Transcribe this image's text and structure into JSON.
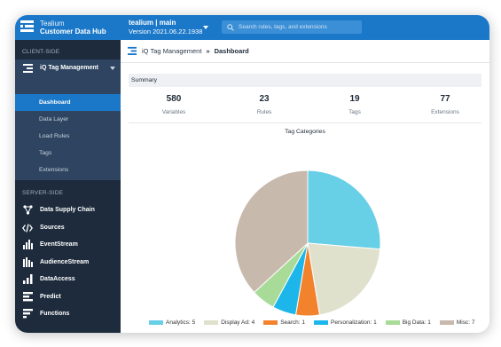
{
  "header": {
    "brand_line1": "Tealium",
    "brand_line2": "Customer Data Hub",
    "account_line": "tealium  |  main",
    "version_line": "Version 2021.06.22.1938",
    "search_placeholder": "Search rules, tags, and extensions"
  },
  "sidebar": {
    "client_title": "CLIENT-SIDE",
    "iq_label": "iQ Tag Management",
    "iq_items": [
      "Dashboard",
      "Data Layer",
      "Load Rules",
      "Tags",
      "Extensions"
    ],
    "server_title": "SERVER-SIDE",
    "server_items": [
      {
        "label": "Data Supply Chain",
        "icon": "data-supply-chain-icon"
      },
      {
        "label": "Sources",
        "icon": "code-icon"
      },
      {
        "label": "EventStream",
        "icon": "eventstream-icon"
      },
      {
        "label": "AudienceStream",
        "icon": "audiencestream-icon"
      },
      {
        "label": "DataAccess",
        "icon": "bar-chart-icon"
      },
      {
        "label": "Predict",
        "icon": "predict-icon"
      },
      {
        "label": "Functions",
        "icon": "functions-icon"
      }
    ]
  },
  "breadcrumb": {
    "parent": "iQ Tag Management",
    "separator": "»",
    "current": "Dashboard"
  },
  "summary": {
    "title": "Summary",
    "stats": [
      {
        "value": "580",
        "label": "Variables"
      },
      {
        "value": "23",
        "label": "Rules"
      },
      {
        "value": "19",
        "label": "Tags"
      },
      {
        "value": "77",
        "label": "Extensions"
      }
    ]
  },
  "colors": {
    "topbar": "#1b78c9",
    "sidebar": "#1d2b3d",
    "active": "#1b78c9"
  },
  "chart_data": {
    "type": "pie",
    "title": "Tag Categories",
    "categories": [
      "Analytics",
      "Display Ad",
      "Search",
      "Personalization",
      "Big Data",
      "Misc"
    ],
    "values": [
      5,
      4,
      1,
      1,
      1,
      7
    ],
    "colors": [
      "#67cfe6",
      "#e0e1cc",
      "#f2822b",
      "#1cb6ea",
      "#a9db98",
      "#c8b9ad"
    ],
    "legend_labels": [
      "Analytics: 5",
      "Display Ad: 4",
      "Search: 1",
      "Personalization: 1",
      "Big Data: 1",
      "Misc: 7"
    ],
    "legend_position": "bottom"
  }
}
